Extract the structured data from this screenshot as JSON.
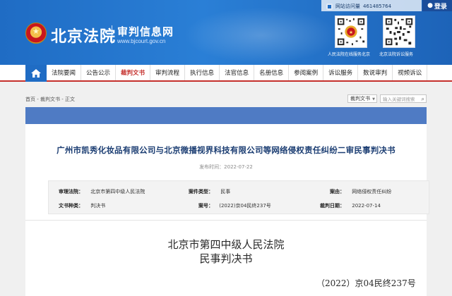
{
  "header": {
    "court_name": "北京法院",
    "site_name": "审判信息网",
    "site_url": "www.bjcourt.gov.cn",
    "visit_label": "网站访问量",
    "visit_count": "461485764",
    "login_label": "登录",
    "qr": [
      {
        "caption": "人民法院在线服务北京"
      },
      {
        "caption": "北京法院诉讼服务"
      }
    ],
    "colors": {
      "banner": "#1f6cc4",
      "accent": "#c5302c"
    }
  },
  "nav": {
    "home_icon": "home-icon",
    "items": [
      {
        "label": "法院要闻"
      },
      {
        "label": "公告公示"
      },
      {
        "label": "裁判文书",
        "active": true
      },
      {
        "label": "审判流程"
      },
      {
        "label": "执行信息"
      },
      {
        "label": "法官信息"
      },
      {
        "label": "名册信息"
      },
      {
        "label": "参阅案例"
      },
      {
        "label": "诉讼服务"
      },
      {
        "label": "数说审判"
      },
      {
        "label": "视频诉讼"
      }
    ]
  },
  "breadcrumb": {
    "path": "首页 - 裁判文书 - 正文",
    "select_value": "裁判文书",
    "search_placeholder": "输入关键词搜索"
  },
  "document": {
    "title": "广州市凯秀化妆品有限公司与北京微播视界科技有限公司等网络侵权责任纠纷二审民事判决书",
    "publish_label": "发布时间：",
    "publish_date": "2022-07-22",
    "meta": {
      "court_key": "审理法院：",
      "court_val": "北京市第四中级人民法院",
      "type_key": "案件类型：",
      "type_val": "民事",
      "cause_key": "案由：",
      "cause_val": "网络侵权责任纠纷",
      "doc_kind_key": "文书种类：",
      "doc_kind_val": "判决书",
      "case_key": "案号：",
      "case_val": "(2022)京04民终237号",
      "date_key": "裁判日期：",
      "date_val": "2022-07-14"
    },
    "court_head": "北京市第四中级人民法院",
    "doc_type": "民事判决书",
    "case_number": "（2022）京04民终237号"
  }
}
